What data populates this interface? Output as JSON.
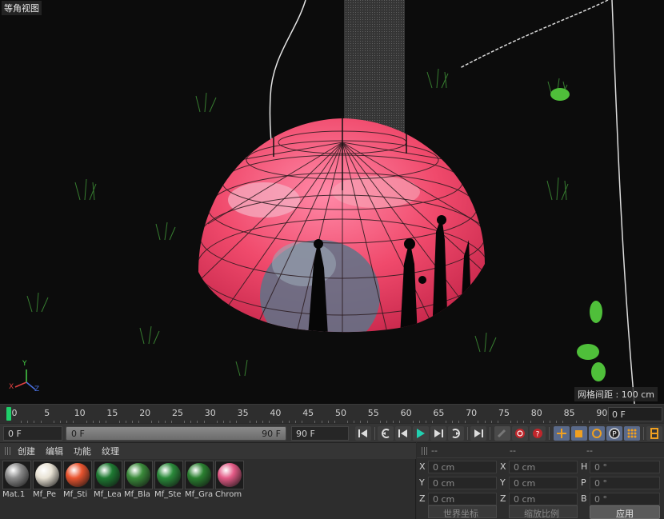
{
  "viewport": {
    "title": "等角视图",
    "grid_spacing": "网格间距 : 100 cm",
    "axis_labels": {
      "x": "X",
      "y": "Y",
      "z": "Z"
    }
  },
  "timeline": {
    "ticks": [
      "0",
      "5",
      "10",
      "15",
      "20",
      "25",
      "30",
      "35",
      "40",
      "45",
      "50",
      "55",
      "60",
      "65",
      "70",
      "75",
      "80",
      "85",
      "90"
    ],
    "frame_end_box": "0 F",
    "playhead_color": "#1fcf6a"
  },
  "transport": {
    "start_field": "0 F",
    "range_start": "0 F",
    "range_end": "90 F",
    "end_field": "90 F",
    "buttons": [
      "go-to-start-icon",
      "step-back-key-icon",
      "play-reverse-icon",
      "play-icon",
      "step-forward-key-icon",
      "go-to-end-icon",
      "record-icon",
      "autokey-icon",
      "help-icon",
      "move-icon",
      "scale-icon",
      "rotate-icon",
      "parameter-icon",
      "grid-points-icon",
      "film-icon"
    ]
  },
  "materials": {
    "menu": [
      "创建",
      "编辑",
      "功能",
      "纹理"
    ],
    "items": [
      {
        "label": "Mat.1",
        "color": "#8a8a8a"
      },
      {
        "label": "Mf_Pe",
        "color": "#e8e2d4"
      },
      {
        "label": "Mf_Sti",
        "color": "#e9542f"
      },
      {
        "label": "Mf_Lea",
        "color": "#1e7a32"
      },
      {
        "label": "Mf_Bla",
        "color": "#3a8a3a"
      },
      {
        "label": "Mf_Ste",
        "color": "#2a8a3a"
      },
      {
        "label": "Mf_Gra",
        "color": "#2a8030"
      },
      {
        "label": "Chrom",
        "color": "#e35a86"
      }
    ]
  },
  "coordinates": {
    "headers": [
      "--",
      "--",
      "--"
    ],
    "position": [
      {
        "axis": "X",
        "value": "0 cm"
      },
      {
        "axis": "Y",
        "value": "0 cm"
      },
      {
        "axis": "Z",
        "value": "0 cm"
      }
    ],
    "size": [
      {
        "axis": "X",
        "value": "0 cm"
      },
      {
        "axis": "Y",
        "value": "0 cm"
      },
      {
        "axis": "Z",
        "value": "0 cm"
      }
    ],
    "rotation": [
      {
        "axis": "H",
        "value": "0 °"
      },
      {
        "axis": "P",
        "value": "0 °"
      },
      {
        "axis": "B",
        "value": "0 °"
      }
    ],
    "coord_mode": "世界坐标",
    "scale_mode": "缩放比例",
    "apply": "应用"
  }
}
